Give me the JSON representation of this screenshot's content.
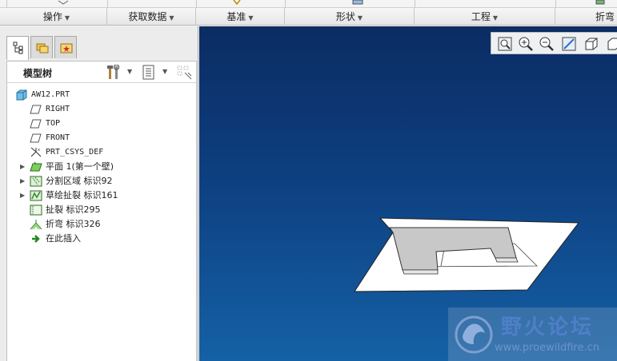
{
  "ribbon": {
    "groups": [
      {
        "label": "操作",
        "caret": "▼"
      },
      {
        "label": "获取数据",
        "caret": "▼"
      },
      {
        "label": "基准",
        "caret": "▼"
      },
      {
        "label": "形状",
        "caret": "▼"
      },
      {
        "label": "工程",
        "caret": "▼"
      },
      {
        "label": "折弯",
        "caret": ""
      }
    ]
  },
  "model_tree": {
    "title": "模型树",
    "items": [
      {
        "label": "AW12.PRT",
        "icon": "part-icon",
        "expandable": false
      },
      {
        "label": "RIGHT",
        "icon": "datum-plane-icon",
        "expandable": false
      },
      {
        "label": "TOP",
        "icon": "datum-plane-icon",
        "expandable": false
      },
      {
        "label": "FRONT",
        "icon": "datum-plane-icon",
        "expandable": false
      },
      {
        "label": "PRT_CSYS_DEF",
        "icon": "csys-icon",
        "expandable": false
      },
      {
        "label": "平面 1(第一个壁)",
        "icon": "planar-wall-icon",
        "expandable": true
      },
      {
        "label": "分割区域 标识92",
        "icon": "split-area-icon",
        "expandable": true
      },
      {
        "label": "草绘扯裂 标识161",
        "icon": "sketch-rip-icon",
        "expandable": true
      },
      {
        "label": "扯裂 标识295",
        "icon": "rip-icon",
        "expandable": false
      },
      {
        "label": "折弯 标识326",
        "icon": "bend-icon",
        "expandable": false
      },
      {
        "label": "在此插入",
        "icon": "insert-here-arrow-icon",
        "expandable": false
      }
    ]
  },
  "watermark": {
    "title": "野火论坛",
    "url": "www.proewildfire.cn"
  },
  "colors": {
    "viewport_top": "#0c2c63",
    "viewport_bottom": "#1561a6",
    "model_face": "#ffffff",
    "model_wall": "#c8c8c8",
    "tree_icon_green": "#2e8b2e"
  }
}
